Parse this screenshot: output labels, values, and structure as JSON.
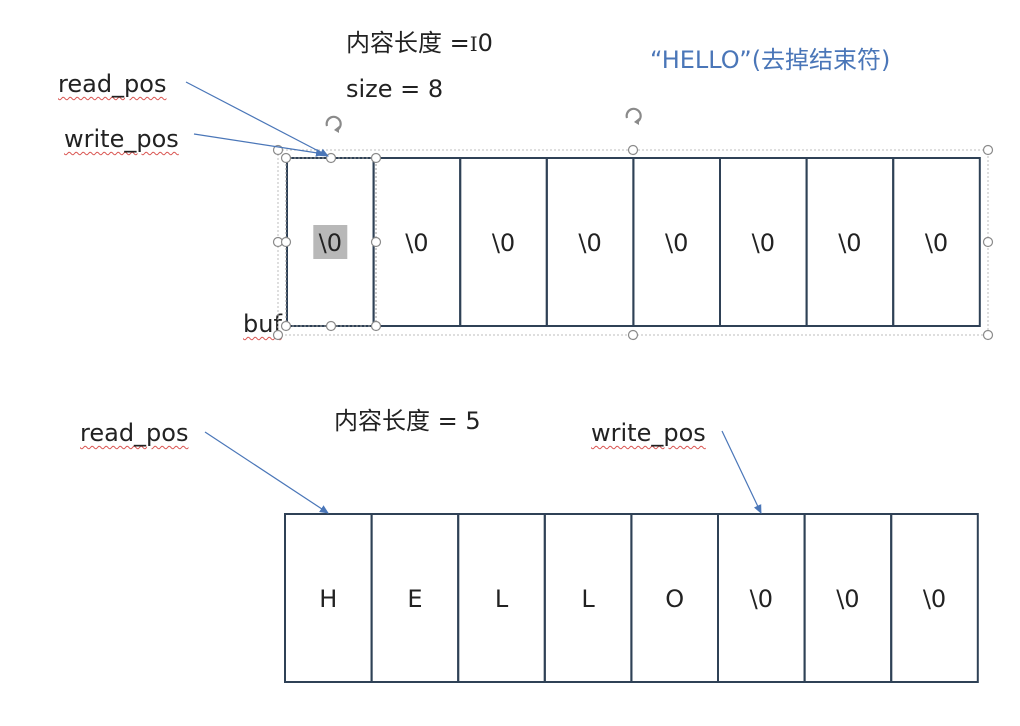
{
  "top": {
    "content_length_label": "内容长度 =",
    "cursor_glyph": "I",
    "content_length_value": "0",
    "size_label": "size = 8",
    "note": "“HELLO”(去掉结束符)",
    "read_pos_label": "read_pos",
    "write_pos_label": "write_pos",
    "buf_label": "buf",
    "cells": [
      "\\0",
      "\\0",
      "\\0",
      "\\0",
      "\\0",
      "\\0",
      "\\0",
      "\\0"
    ],
    "selected_cell_index": 0
  },
  "bottom": {
    "content_length_label": "内容长度 = 5",
    "read_pos_label": "read_pos",
    "write_pos_label": "write_pos",
    "cells": [
      "H",
      "E",
      "L",
      "L",
      "O",
      "\\0",
      "\\0",
      "\\0"
    ],
    "read_pos_index": 0,
    "write_pos_index": 5
  },
  "colors": {
    "cell_border": "#2f4156",
    "arrow": "#4a76b8",
    "handle": "#8a8a8a",
    "selection_fill": "#b8b8b8",
    "squiggle": "#d9534f",
    "note_text": "#4a76b8"
  }
}
